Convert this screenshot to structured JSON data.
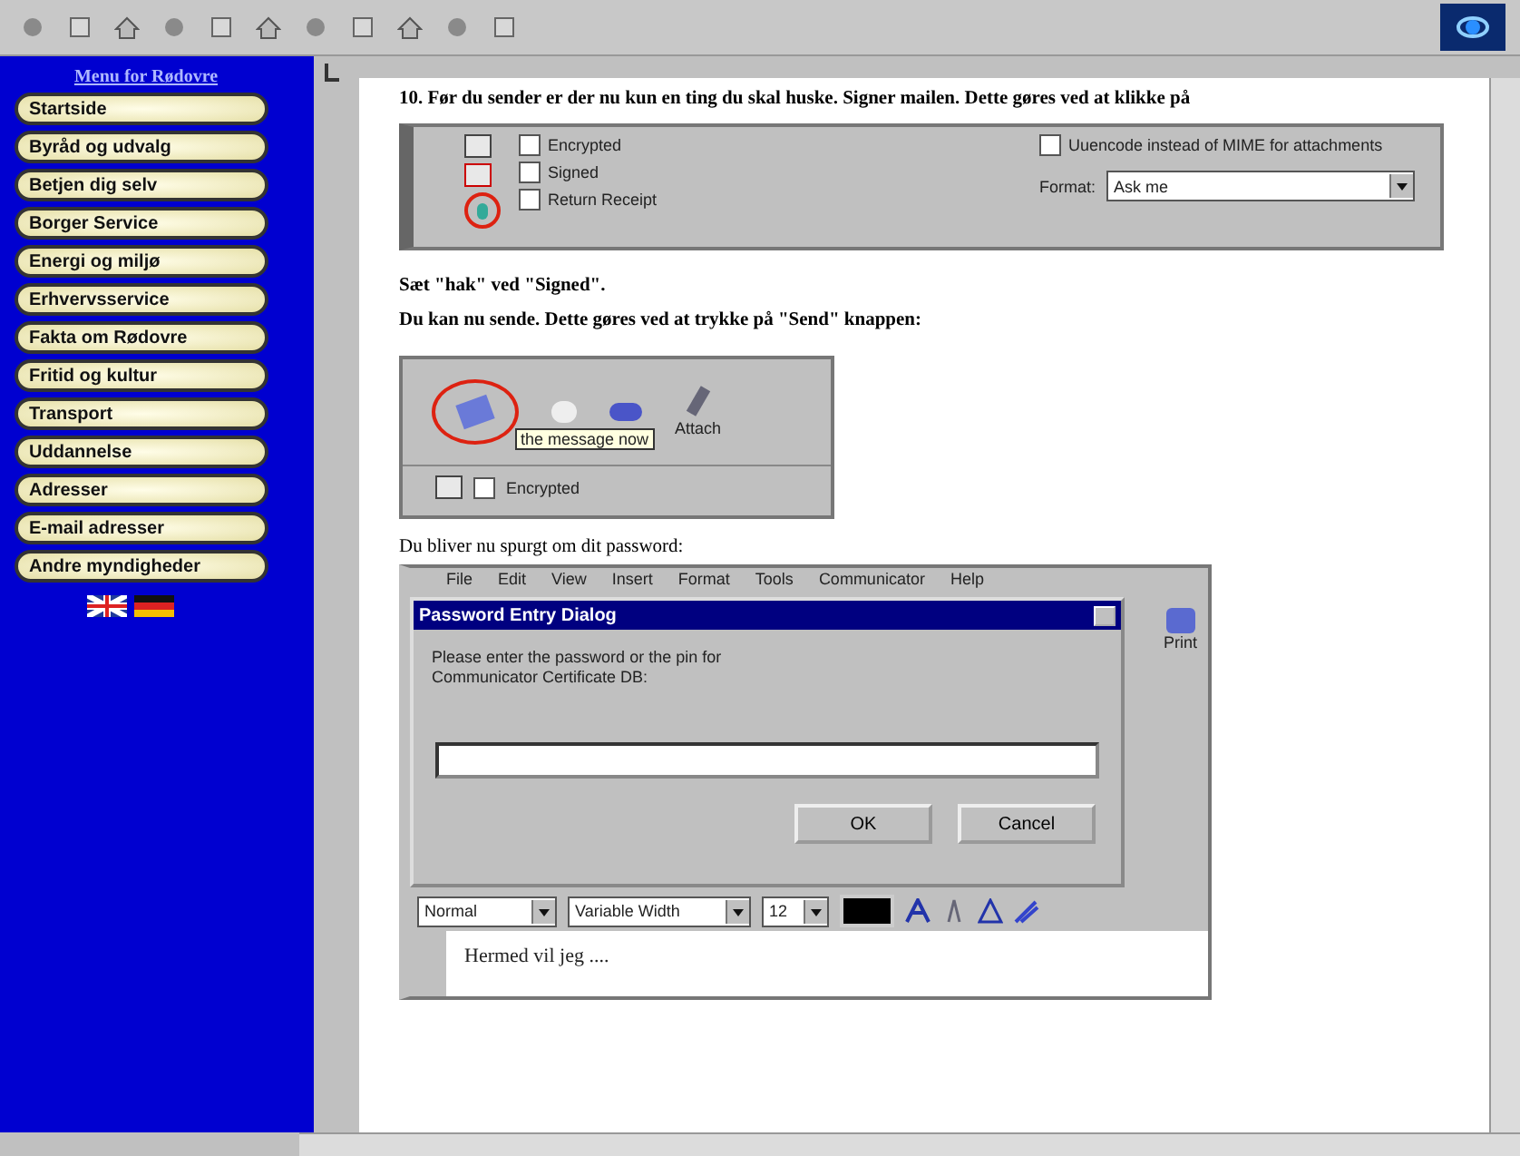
{
  "sidebar": {
    "title": "Menu for Rødovre",
    "items": [
      {
        "label": "Startside"
      },
      {
        "label": "Byråd og udvalg"
      },
      {
        "label": "Betjen dig selv"
      },
      {
        "label": "Borger Service"
      },
      {
        "label": "Energi og miljø"
      },
      {
        "label": "Erhvervsservice"
      },
      {
        "label": "Fakta om Rødovre"
      },
      {
        "label": "Fritid og kultur"
      },
      {
        "label": "Transport"
      },
      {
        "label": "Uddannelse"
      },
      {
        "label": "Adresser"
      },
      {
        "label": "E-mail adresser"
      },
      {
        "label": "Andre myndigheder"
      }
    ]
  },
  "step_text": "10. Før du sender er der nu kun en ting du skal huske. Signer mailen. Dette gøres ved at klikke på",
  "options_panel": {
    "checkboxes": [
      {
        "label": "Encrypted",
        "checked": false
      },
      {
        "label": "Signed",
        "checked": false
      },
      {
        "label": "Return Receipt",
        "checked": false
      }
    ],
    "uuencode": {
      "label": "Uuencode instead of MIME for attachments",
      "checked": false
    },
    "format_label": "Format:",
    "format_value": "Ask me"
  },
  "instruction_1": "Sæt \"hak\" ved \"Signed\".",
  "instruction_2": "Du kan nu sende. Dette gøres ved at trykke på \"Send\" knappen:",
  "send_toolbar": {
    "tooltip": "the message now",
    "attach_label": "Attach",
    "encrypted_label": "Encrypted",
    "encrypted_checked": false
  },
  "password_text": "Du bliver nu spurgt om dit password:",
  "composer": {
    "menu": [
      "File",
      "Edit",
      "View",
      "Insert",
      "Format",
      "Tools",
      "Communicator",
      "Help"
    ],
    "print_label": "Print",
    "format_bar": {
      "style": "Normal",
      "font": "Variable Width",
      "size": "12"
    },
    "body": "Hermed vil jeg ....",
    "dialog": {
      "title": "Password Entry Dialog",
      "message": [
        "Please enter the password or the pin for",
        "Communicator Certificate DB:"
      ],
      "buttons": [
        "OK",
        "Cancel"
      ]
    }
  }
}
